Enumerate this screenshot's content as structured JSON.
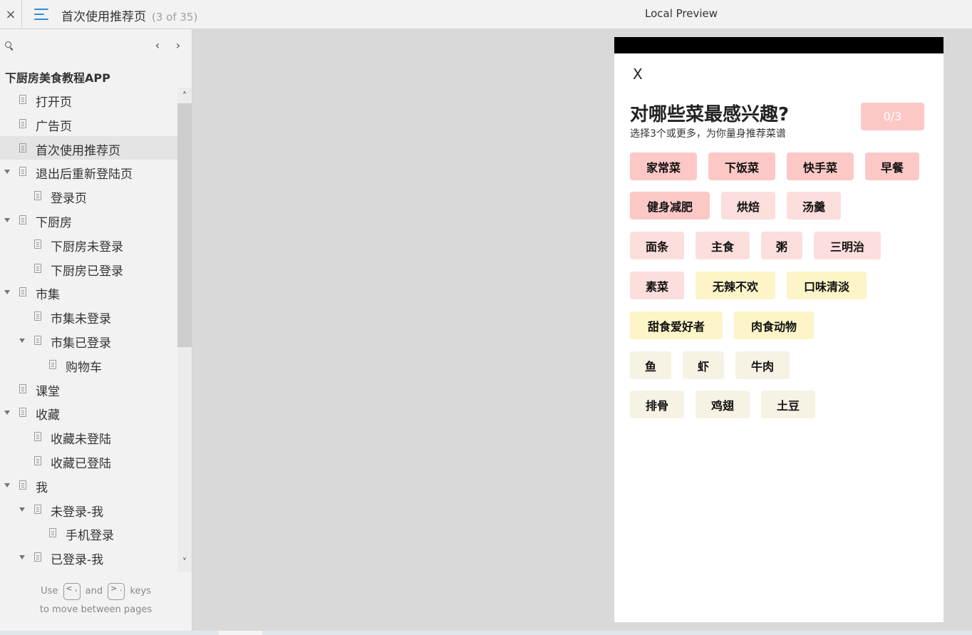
{
  "topbar": {
    "close_icon": "×",
    "menu_icon": "hamburger-menu-icon",
    "page_title": "首次使用推荐页",
    "page_count": "(3 of 35)",
    "preview_label": "Local Preview"
  },
  "sidebar": {
    "prev_label": "‹",
    "next_label": "›",
    "project_title": "下厨房美食教程APP",
    "items": [
      {
        "label": "打开页",
        "level": 0,
        "expandable": false,
        "selected": false
      },
      {
        "label": "广告页",
        "level": 0,
        "expandable": false,
        "selected": false
      },
      {
        "label": "首次使用推荐页",
        "level": 0,
        "expandable": false,
        "selected": true
      },
      {
        "label": "退出后重新登陆页",
        "level": 0,
        "expandable": true,
        "selected": false
      },
      {
        "label": "登录页",
        "level": 1,
        "expandable": false,
        "selected": false
      },
      {
        "label": "下厨房",
        "level": 0,
        "expandable": true,
        "selected": false
      },
      {
        "label": "下厨房未登录",
        "level": 1,
        "expandable": false,
        "selected": false
      },
      {
        "label": "下厨房已登录",
        "level": 1,
        "expandable": false,
        "selected": false
      },
      {
        "label": "市集",
        "level": 0,
        "expandable": true,
        "selected": false
      },
      {
        "label": "市集未登录",
        "level": 1,
        "expandable": false,
        "selected": false
      },
      {
        "label": "市集已登录",
        "level": 1,
        "expandable": true,
        "selected": false
      },
      {
        "label": "购物车",
        "level": 2,
        "expandable": false,
        "selected": false
      },
      {
        "label": "课堂",
        "level": 0,
        "expandable": false,
        "selected": false
      },
      {
        "label": "收藏",
        "level": 0,
        "expandable": true,
        "selected": false
      },
      {
        "label": "收藏未登陆",
        "level": 1,
        "expandable": false,
        "selected": false
      },
      {
        "label": "收藏已登陆",
        "level": 1,
        "expandable": false,
        "selected": false
      },
      {
        "label": "我",
        "level": 0,
        "expandable": true,
        "selected": false
      },
      {
        "label": "未登录-我",
        "level": 1,
        "expandable": true,
        "selected": false
      },
      {
        "label": "手机登录",
        "level": 2,
        "expandable": false,
        "selected": false
      },
      {
        "label": "已登录-我",
        "level": 1,
        "expandable": true,
        "selected": false
      }
    ],
    "hint": {
      "use": "Use",
      "key_prev": "< ,",
      "and": "and",
      "key_next": "> .",
      "keys": "keys",
      "line2": "to move between pages"
    }
  },
  "phone": {
    "close_label": "X",
    "title": "对哪些菜最感兴趣?",
    "subtitle": "选择3个或更多，为你量身推荐菜谱",
    "count_label": "0/3",
    "tag_rows": [
      [
        {
          "label": "家常菜",
          "color": "#fcc8c6"
        },
        {
          "label": "下饭菜",
          "color": "#fcc8c6"
        },
        {
          "label": "快手菜",
          "color": "#fcc8c6"
        },
        {
          "label": "早餐",
          "color": "#fcc8c6"
        }
      ],
      [
        {
          "label": "健身减肥",
          "color": "#fcc8c6"
        },
        {
          "label": "烘焙",
          "color": "#fcdedc"
        },
        {
          "label": "汤羹",
          "color": "#fcdedc"
        }
      ],
      [
        {
          "label": "面条",
          "color": "#fcdedc"
        },
        {
          "label": "主食",
          "color": "#fcdedc"
        },
        {
          "label": "粥",
          "color": "#fcdedc"
        },
        {
          "label": "三明治",
          "color": "#fcdedc"
        }
      ],
      [
        {
          "label": "素菜",
          "color": "#fcdedc"
        },
        {
          "label": "无辣不欢",
          "color": "#fdf4c8"
        },
        {
          "label": "口味清淡",
          "color": "#fdf4c8"
        }
      ],
      [
        {
          "label": "甜食爱好者",
          "color": "#fdf4c8"
        },
        {
          "label": "肉食动物",
          "color": "#fdf4c8"
        }
      ],
      [
        {
          "label": "鱼",
          "color": "#f6f2e4"
        },
        {
          "label": "虾",
          "color": "#f6f2e4"
        },
        {
          "label": "牛肉",
          "color": "#f6f2e4"
        }
      ],
      [
        {
          "label": "排骨",
          "color": "#f6f2e4"
        },
        {
          "label": "鸡翅",
          "color": "#f6f2e4"
        },
        {
          "label": "土豆",
          "color": "#f6f2e4"
        }
      ]
    ]
  }
}
